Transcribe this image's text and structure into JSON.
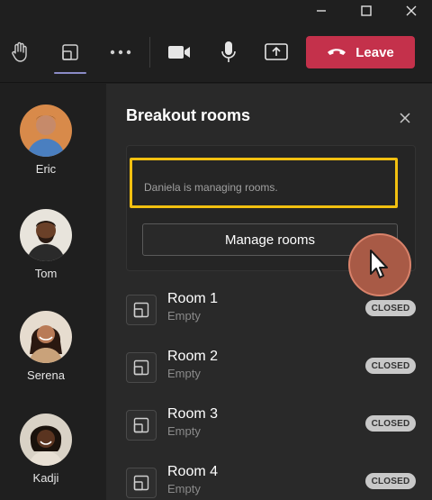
{
  "toolbar": {
    "leave_label": "Leave"
  },
  "participants": [
    {
      "name": "Eric"
    },
    {
      "name": "Tom"
    },
    {
      "name": "Serena"
    },
    {
      "name": "Kadji"
    }
  ],
  "panel": {
    "title": "Breakout rooms",
    "managing_text": "Daniela is managing rooms.",
    "manage_button_label": "Manage rooms",
    "rooms": [
      {
        "name": "Room 1",
        "status": "Empty",
        "badge": "CLOSED"
      },
      {
        "name": "Room 2",
        "status": "Empty",
        "badge": "CLOSED"
      },
      {
        "name": "Room 3",
        "status": "Empty",
        "badge": "CLOSED"
      },
      {
        "name": "Room 4",
        "status": "Empty",
        "badge": "CLOSED"
      }
    ]
  },
  "colors": {
    "leave": "#c4314b",
    "highlight": "#f2c010",
    "accent_underline": "#8b8cc7",
    "badge_bg": "#c8c8c8"
  },
  "icons": {
    "window": [
      "minimize-icon",
      "maximize-icon",
      "close-icon"
    ],
    "toolbar": [
      "raise-hand-icon",
      "breakout-rooms-icon",
      "more-icon",
      "camera-icon",
      "microphone-icon",
      "share-icon",
      "phone-hangup-icon"
    ]
  }
}
